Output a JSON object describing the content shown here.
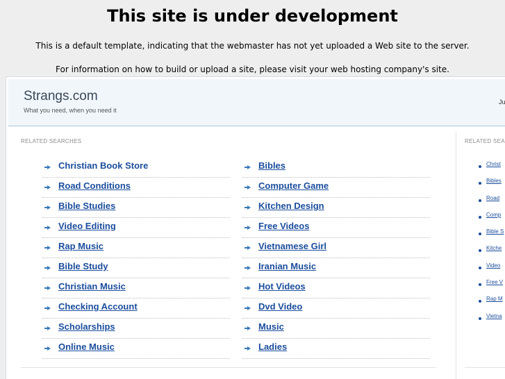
{
  "banner": {
    "title": "This site is under development",
    "line1": "This is a default template, indicating that the webmaster has not yet uploaded a Web site to the server.",
    "line2": "For information on how to build or upload a site, please visit your web hosting company's site."
  },
  "site": {
    "name": "Strangs.com",
    "tagline": "What you need, when you need it",
    "date": "Ju"
  },
  "related": {
    "title": "RELATED SEARCHES",
    "left": [
      "Christian Book Store",
      "Road Conditions",
      "Bible Studies",
      "Video Editing",
      "Rap Music",
      "Bible Study",
      "Christian Music",
      "Checking Account",
      "Scholarships",
      "Online Music"
    ],
    "right": [
      "Bibles",
      "Computer Game",
      "Kitchen Design",
      "Free Videos",
      "Vietnamese Girl",
      "Iranian Music",
      "Hot Videos",
      "Dvd Video",
      "Music",
      "Ladies"
    ]
  },
  "sidebar": {
    "title": "RELATED SEA",
    "items": [
      "Christ",
      "Bibles",
      "Road",
      "Comp",
      "Bible S",
      "Kitche",
      "Video",
      "Free V",
      "Rap M",
      "Vietna"
    ]
  },
  "colors": {
    "link": "#1b4d9c",
    "header_bg": "#f1f6fa",
    "page_bg": "#eeeeee"
  },
  "icons": {
    "link_marker": "arrow-icon",
    "side_marker": "bullet-icon"
  }
}
